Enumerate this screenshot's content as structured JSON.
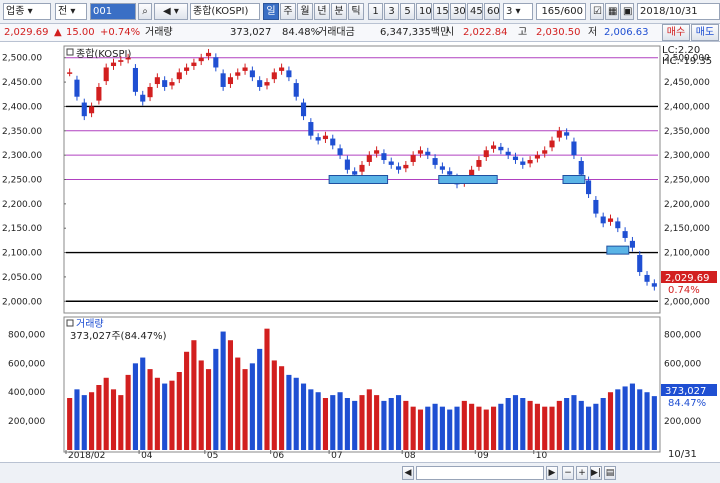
{
  "toolbar": {
    "market_select": "업종",
    "period_select": "전",
    "code_value": "001",
    "index_name": "종합(KOSPI)",
    "period_tabs": [
      "일",
      "주",
      "월",
      "년",
      "분",
      "틱"
    ],
    "active_tab": "일",
    "interval_buttons": [
      "1",
      "3",
      "5",
      "10",
      "15",
      "30",
      "45",
      "60"
    ],
    "interval_select": "3",
    "count_value": "165",
    "count_total": "600",
    "date_value": "2018/10/31",
    "buy_label": "매수",
    "sell_label": "매도"
  },
  "infobar": {
    "price": "2,029.69",
    "change": "15.00",
    "change_pct": "+0.74%",
    "volume_label": "거래량",
    "volume": "373,027",
    "volume_ratio": "84.48%",
    "amount_label": "거래대금",
    "amount": "6,347,335백만",
    "open_label": "시",
    "open": "2,022.84",
    "high_label": "고",
    "high": "2,030.50",
    "low_label": "저",
    "low": "2,006.63"
  },
  "price_panel": {
    "title": "종합(KOSPI)",
    "lc_label": "LC:2.20",
    "hc_label": "HC:-19.35",
    "current_label": "2,029.69",
    "pct_label": "0.74%"
  },
  "volume_panel": {
    "title": "거래량",
    "subtitle": "373,027주(84.47%)",
    "current_label": "373,027",
    "pct_label": "84.47%"
  },
  "colors": {
    "up": "#d21f1f",
    "down": "#1f4fd2",
    "hline_purple": "#b040c0",
    "hline_black": "#000000",
    "highlight": "#5ab4e6"
  },
  "chart_data": {
    "type": "candlestick",
    "price_ylim": [
      1980,
      2520
    ],
    "price_ticks": [
      2000,
      2050,
      2100,
      2150,
      2200,
      2250,
      2300,
      2350,
      2400,
      2450,
      2500
    ],
    "price_tick_labels": [
      "2,000.00",
      "2,050.00",
      "2,100.00",
      "2,150.00",
      "2,200.00",
      "2,250.00",
      "2,300.00",
      "2,350.00",
      "2,400.00",
      "2,450.00",
      "2,500.00"
    ],
    "price_tick_labels_right": [
      "2,000,000",
      "2,050,000",
      "2,100,000",
      "2,150,000",
      "2,200,000",
      "2,250,000",
      "2,300,000",
      "2,350,000",
      "2,400,000",
      "2,450,000",
      "2,500,000"
    ],
    "hlines": [
      {
        "value": 2500,
        "color": "purple"
      },
      {
        "value": 2400,
        "color": "black"
      },
      {
        "value": 2350,
        "color": "purple"
      },
      {
        "value": 2300,
        "color": "purple"
      },
      {
        "value": 2250,
        "color": "purple"
      },
      {
        "value": 2100,
        "color": "black"
      },
      {
        "value": 2000,
        "color": "black"
      }
    ],
    "price_path": [
      2470,
      2420,
      2380,
      2400,
      2440,
      2480,
      2490,
      2495,
      2500,
      2430,
      2410,
      2440,
      2460,
      2440,
      2450,
      2470,
      2480,
      2490,
      2500,
      2510,
      2480,
      2440,
      2460,
      2470,
      2480,
      2460,
      2440,
      2450,
      2470,
      2480,
      2460,
      2420,
      2380,
      2340,
      2330,
      2340,
      2320,
      2300,
      2270,
      2260,
      2280,
      2300,
      2310,
      2290,
      2280,
      2270,
      2280,
      2300,
      2310,
      2300,
      2280,
      2270,
      2260,
      2240,
      2250,
      2270,
      2290,
      2310,
      2320,
      2310,
      2300,
      2290,
      2280,
      2290,
      2300,
      2310,
      2330,
      2350,
      2340,
      2300,
      2260,
      2220,
      2180,
      2160,
      2170,
      2150,
      2130,
      2110,
      2060,
      2040,
      2030
    ],
    "highlight_boxes": [
      {
        "x_index": 36,
        "width": 8,
        "value": 2250
      },
      {
        "x_index": 51,
        "width": 8,
        "value": 2250
      },
      {
        "x_index": 68,
        "width": 3,
        "value": 2250
      },
      {
        "x_index": 74,
        "width": 3,
        "value": 2105
      }
    ],
    "volume_ylim": [
      0,
      900000
    ],
    "volume_ticks": [
      200000,
      400000,
      600000,
      800000
    ],
    "volume_tick_labels": [
      "200,000",
      "400,000",
      "600,000",
      "800,000"
    ],
    "volume_path": [
      360,
      420,
      380,
      400,
      450,
      500,
      420,
      380,
      520,
      600,
      640,
      560,
      500,
      460,
      480,
      540,
      680,
      760,
      620,
      560,
      700,
      820,
      760,
      640,
      560,
      600,
      700,
      840,
      620,
      580,
      520,
      500,
      460,
      420,
      400,
      360,
      380,
      400,
      360,
      340,
      380,
      420,
      380,
      340,
      360,
      380,
      340,
      300,
      280,
      300,
      320,
      300,
      280,
      300,
      340,
      320,
      300,
      280,
      300,
      320,
      360,
      380,
      360,
      340,
      320,
      300,
      300,
      340,
      360,
      380,
      340,
      300,
      320,
      360,
      400,
      420,
      440,
      460,
      420,
      400,
      373
    ],
    "x_labels": [
      "2018/02",
      "04",
      "05",
      "06",
      "07",
      "08",
      "09",
      "10"
    ],
    "x_label_index": [
      0,
      10,
      19,
      28,
      36,
      46,
      56,
      64
    ],
    "end_date_label": "10/31"
  }
}
